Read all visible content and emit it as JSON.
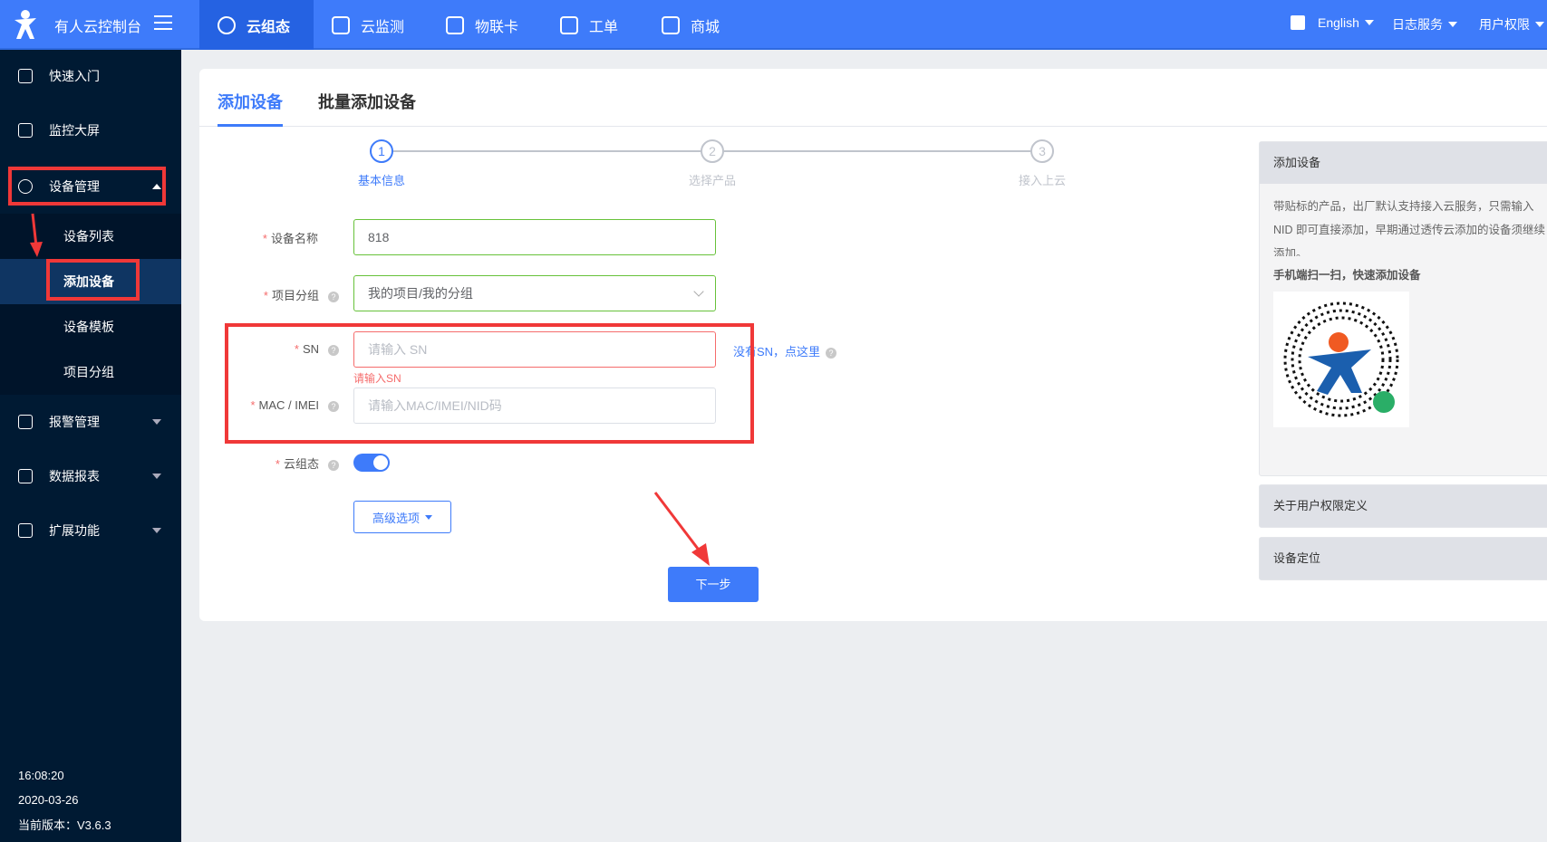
{
  "header": {
    "brand": "有人云控制台",
    "nav": [
      "云组态",
      "云监测",
      "物联卡",
      "工单",
      "商城"
    ],
    "active_nav": "云组态",
    "language": "English",
    "log_service": "日志服务",
    "user_permission": "用户权限"
  },
  "sidebar": {
    "items": [
      "快速入门",
      "监控大屏",
      "设备管理",
      "报警管理",
      "数据报表",
      "扩展功能"
    ],
    "sub_items": [
      "设备列表",
      "添加设备",
      "设备模板",
      "项目分组"
    ],
    "active_sub": "添加设备",
    "time": "16:08:20",
    "date": "2020-03-26",
    "version": "当前版本：V3.6.3"
  },
  "tabs": [
    "添加设备",
    "批量添加设备"
  ],
  "steps": [
    {
      "num": "1",
      "label": "基本信息"
    },
    {
      "num": "2",
      "label": "选择产品"
    },
    {
      "num": "3",
      "label": "接入上云"
    }
  ],
  "form": {
    "device_name": {
      "label": "设备名称",
      "value": "818"
    },
    "project_group": {
      "label": "项目分组",
      "value": "我的项目/我的分组"
    },
    "sn": {
      "label": "SN",
      "placeholder": "请输入 SN",
      "error": "请输入SN",
      "link": "没有SN，点这里"
    },
    "mac": {
      "label": "MAC / IMEI",
      "placeholder": "请输入MAC/IMEI/NID码"
    },
    "cloud_config": {
      "label": "云组态",
      "enabled": true
    },
    "advanced": "高级选项",
    "next": "下一步"
  },
  "help_panel": {
    "title": "添加设备",
    "text": "带贴标的产品，出厂默认支持接入云服务，只需输入 NID 即可直接添加，早期通过透传云添加的设备须继续添加。",
    "scan_title": "手机端扫一扫，快速添加设备",
    "panels": [
      "关于用户权限定义",
      "设备定位"
    ]
  },
  "colors": {
    "primary": "#3e7bfa",
    "sidebar": "#001a33",
    "annotation": "#f03838"
  }
}
